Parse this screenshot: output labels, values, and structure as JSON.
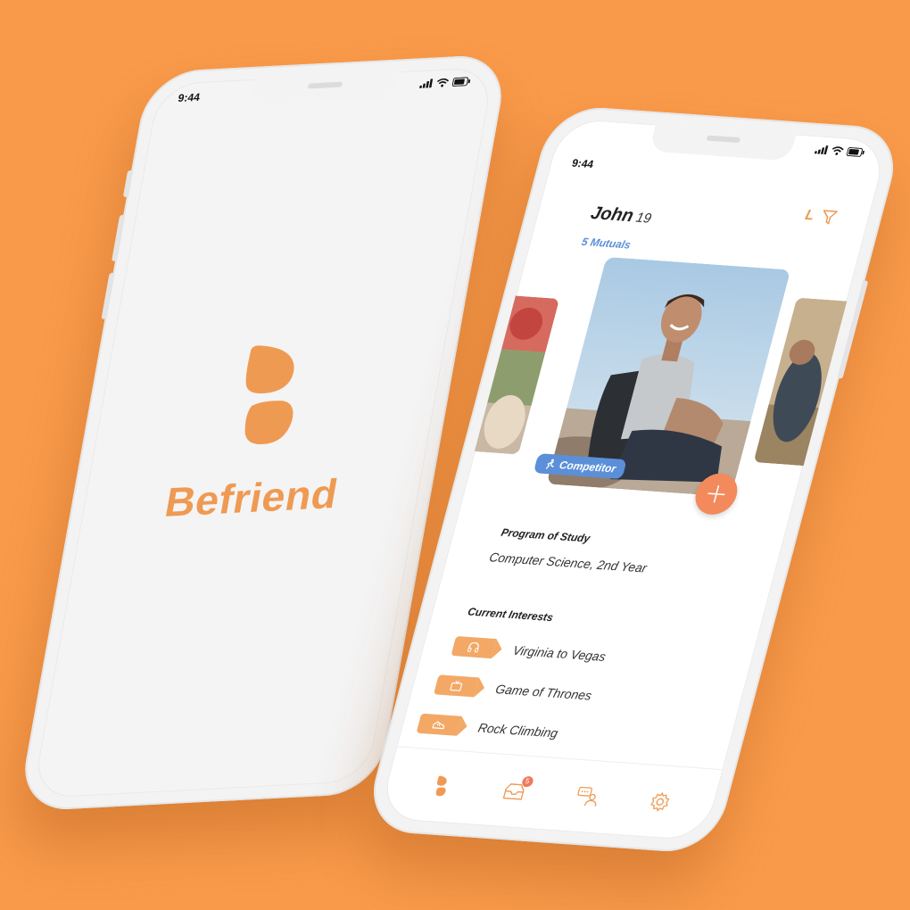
{
  "left_phone": {
    "status_time": "9:44",
    "app_name": "Befriend"
  },
  "right_phone": {
    "status_time": "9:44",
    "profile": {
      "name": "John",
      "age": "19",
      "mutuals": "5 Mutuals",
      "badge": "Competitor"
    },
    "top_actions": {
      "letter": "L"
    },
    "program": {
      "title": "Program of Study",
      "value": "Computer Science, 2nd Year"
    },
    "interests": {
      "title": "Current Interests",
      "items": [
        {
          "label": "Virginia to Vegas",
          "icon": "headphones-icon"
        },
        {
          "label": "Game of Thrones",
          "icon": "tv-icon"
        },
        {
          "label": "Rock Climbing",
          "icon": "climbing-shoe-icon"
        }
      ]
    },
    "tabbar": {
      "items": [
        {
          "name": "home",
          "icon": "befriend-logo-icon"
        },
        {
          "name": "inbox",
          "icon": "inbox-icon",
          "badge": "5"
        },
        {
          "name": "chat",
          "icon": "chat-people-icon"
        },
        {
          "name": "settings",
          "icon": "gear-icon"
        }
      ]
    },
    "colors": {
      "accent": "#ef9a53",
      "blue": "#5b8fd8",
      "fab": "#f28a5c"
    }
  },
  "background_color": "#f99a4a"
}
